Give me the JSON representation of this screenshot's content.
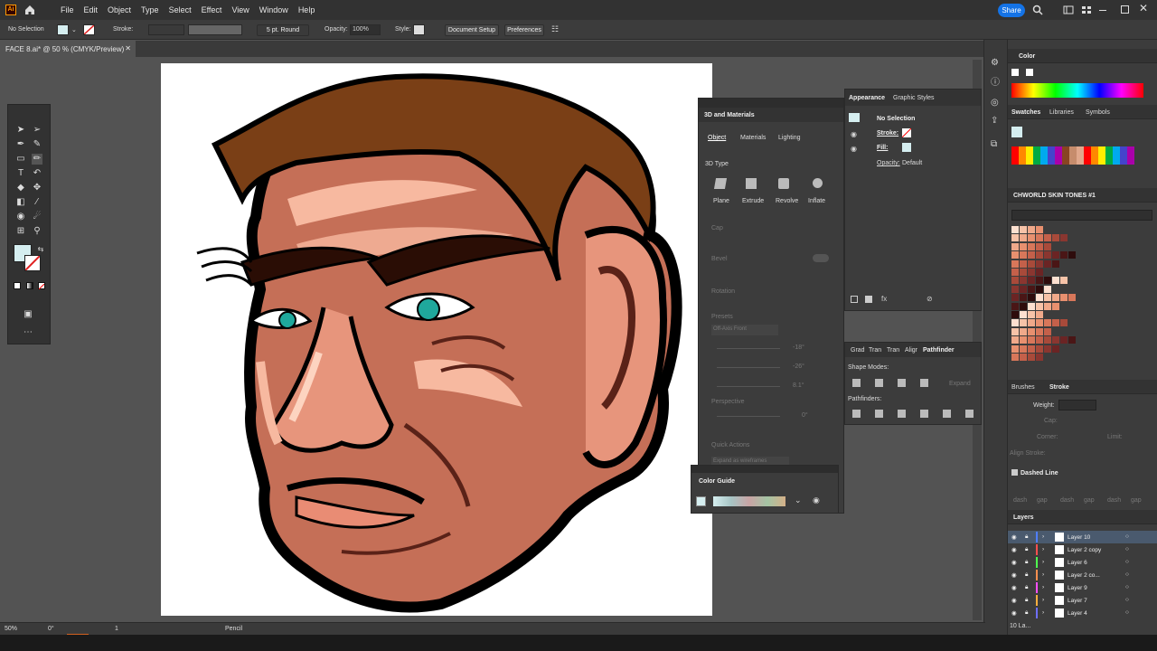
{
  "menubar": {
    "logo": "Ai",
    "items": [
      "File",
      "Edit",
      "Object",
      "Type",
      "Select",
      "Effect",
      "View",
      "Window",
      "Help"
    ],
    "share_label": "Share"
  },
  "control_bar": {
    "selection": "No Selection",
    "stroke_label": "Stroke:",
    "brush": "5 pt. Round",
    "opacity_label": "Opacity:",
    "opacity_value": "100%",
    "style_label": "Style:",
    "document_setup": "Document Setup",
    "preferences": "Preferences"
  },
  "document_tab": {
    "title": "FACE 8.ai* @ 50 % (CMYK/Preview)"
  },
  "status_bar": {
    "zoom": "50%",
    "rotation": "0°",
    "artboard": "1",
    "tool": "Pencil"
  },
  "panel_3d": {
    "title": "3D and Materials",
    "tabs": [
      "Object",
      "Materials",
      "Lighting"
    ],
    "type_label": "3D Type",
    "types": [
      "Plane",
      "Extrude",
      "Revolve",
      "Inflate"
    ],
    "cap": "Cap",
    "bevel": "Bevel",
    "rotation": "Rotation",
    "presets": "Presets",
    "preset_value": "Off-Axis Front",
    "x_val": "-18°",
    "y_val": "-26°",
    "z_val": "8.1°",
    "perspective": "Perspective",
    "persp_val": "0°",
    "quick_actions": "Quick Actions",
    "expand": "Expand as wireframes"
  },
  "appearance": {
    "tabs": [
      "Appearance",
      "Graphic Styles"
    ],
    "selection": "No Selection",
    "stroke": "Stroke:",
    "fill": "Fill:",
    "opacity": "Opacity:",
    "opacity_value": "Default"
  },
  "pathfinder": {
    "tabs": [
      "Grad",
      "Tran",
      "Tran",
      "Aligr",
      "Pathfinder"
    ],
    "shape_modes": "Shape Modes:",
    "expand": "Expand",
    "pathfinders": "Pathfinders:"
  },
  "color_guide": {
    "title": "Color Guide"
  },
  "color_panel": {
    "title": "Color"
  },
  "swatches": {
    "tabs": [
      "Swatches",
      "Libraries",
      "Symbols"
    ],
    "library_name": "CHWORLD SKIN TONES #1",
    "colors": [
      "#fde0d0",
      "#f7c3a8",
      "#f0a98a",
      "#e8906f",
      "#d8775a",
      "#c4604a",
      "#a84a3a",
      "#8a3630",
      "#6b2424",
      "#4a1616",
      "#2e0c0c"
    ]
  },
  "stroke_panel": {
    "tabs": [
      "Brushes",
      "Stroke"
    ],
    "weight": "Weight:",
    "cap": "Cap:",
    "corner": "Corner:",
    "limit": "Limit:",
    "align": "Align Stroke:",
    "dashed": "Dashed Line",
    "dash_labels": [
      "dash",
      "gap",
      "dash",
      "gap",
      "dash",
      "gap"
    ]
  },
  "layers": {
    "title": "Layers",
    "items": [
      {
        "name": "Layer 10",
        "color": "#4f7fff"
      },
      {
        "name": "Layer 2 copy",
        "color": "#ff4f4f"
      },
      {
        "name": "Layer 6",
        "color": "#4fff4f"
      },
      {
        "name": "Layer 2 co...",
        "color": "#ff8f4f"
      },
      {
        "name": "Layer 9",
        "color": "#ff4fff"
      },
      {
        "name": "Layer 7",
        "color": "#ffaf3f"
      },
      {
        "name": "Layer 4",
        "color": "#6f6fff"
      }
    ],
    "footer": "10 La..."
  }
}
